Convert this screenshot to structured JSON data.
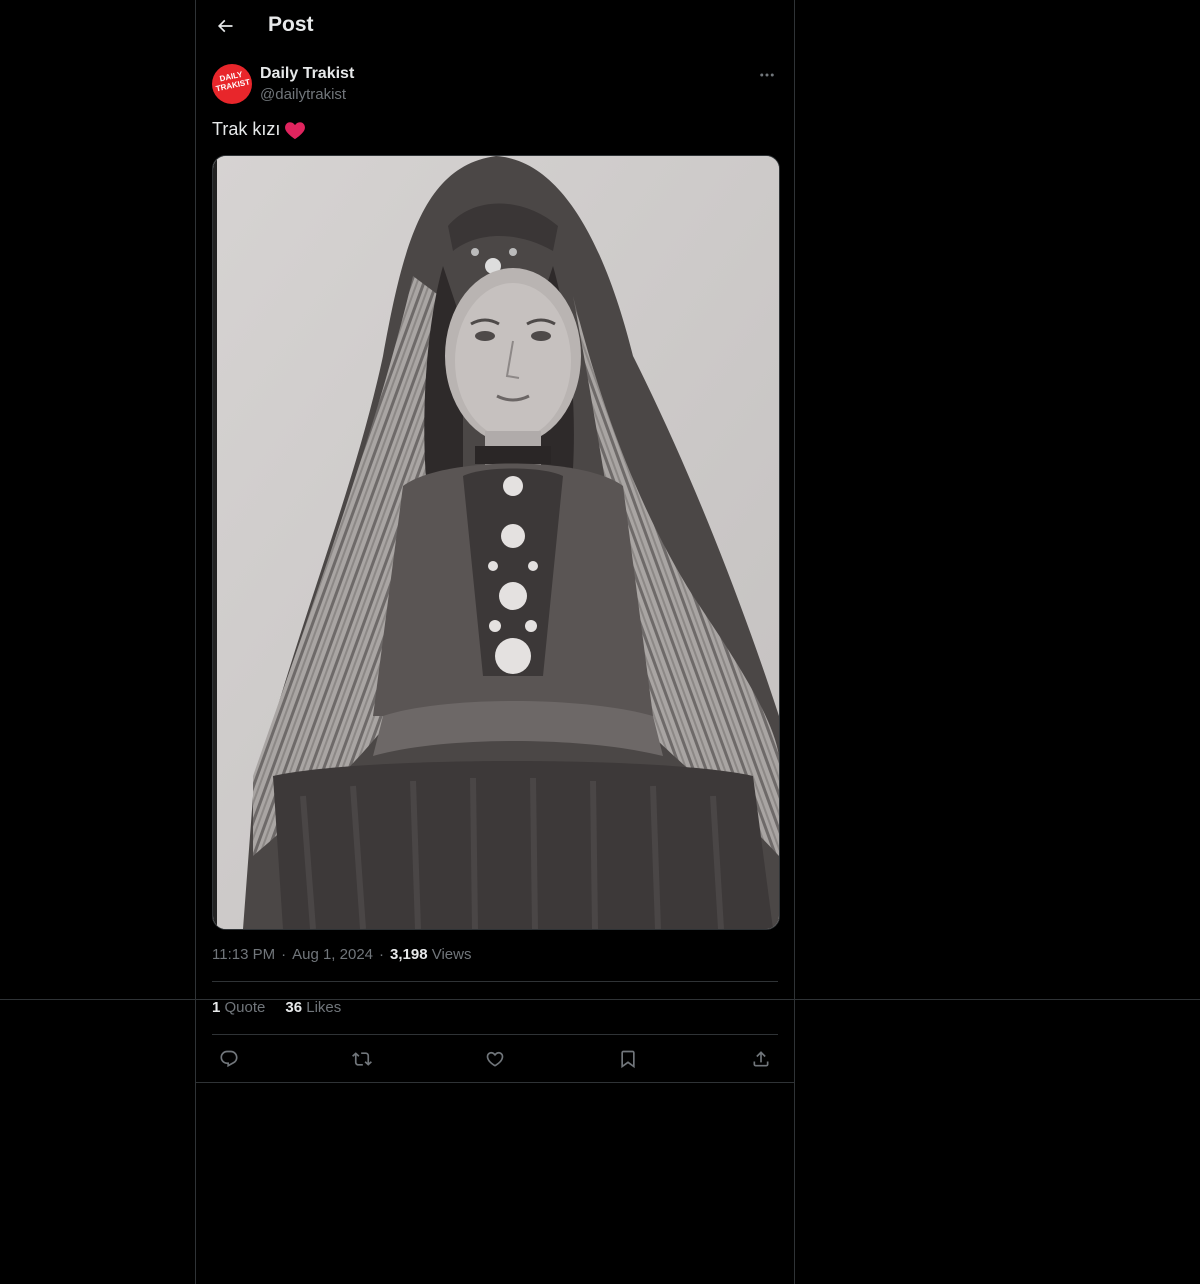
{
  "header": {
    "title": "Post",
    "back_icon": "arrow-left-icon"
  },
  "author": {
    "display_name": "Daily Trakist",
    "handle": "@dailytrakist",
    "avatar_text_line1": "DAILY",
    "avatar_text_line2": "TRAKIST",
    "avatar_color": "#e8262b"
  },
  "post": {
    "text": "Trak kızı",
    "emoji": "❤️",
    "image_alt": "Black and white photograph of a young woman in traditional Thracian dress with a striped headscarf"
  },
  "meta": {
    "time": "11:13 PM",
    "separator": "·",
    "date": "Aug 1, 2024",
    "views_count": "3,198",
    "views_label": "Views"
  },
  "stats": {
    "quotes_count": "1",
    "quotes_label": "Quote",
    "likes_count": "36",
    "likes_label": "Likes"
  },
  "actions": [
    "reply-icon",
    "repost-icon",
    "like-icon",
    "bookmark-icon",
    "share-icon"
  ],
  "colors": {
    "background": "#000000",
    "border": "#2f3336",
    "text_primary": "#e7e9ea",
    "text_secondary": "#71767b",
    "heart": "#f91880"
  }
}
